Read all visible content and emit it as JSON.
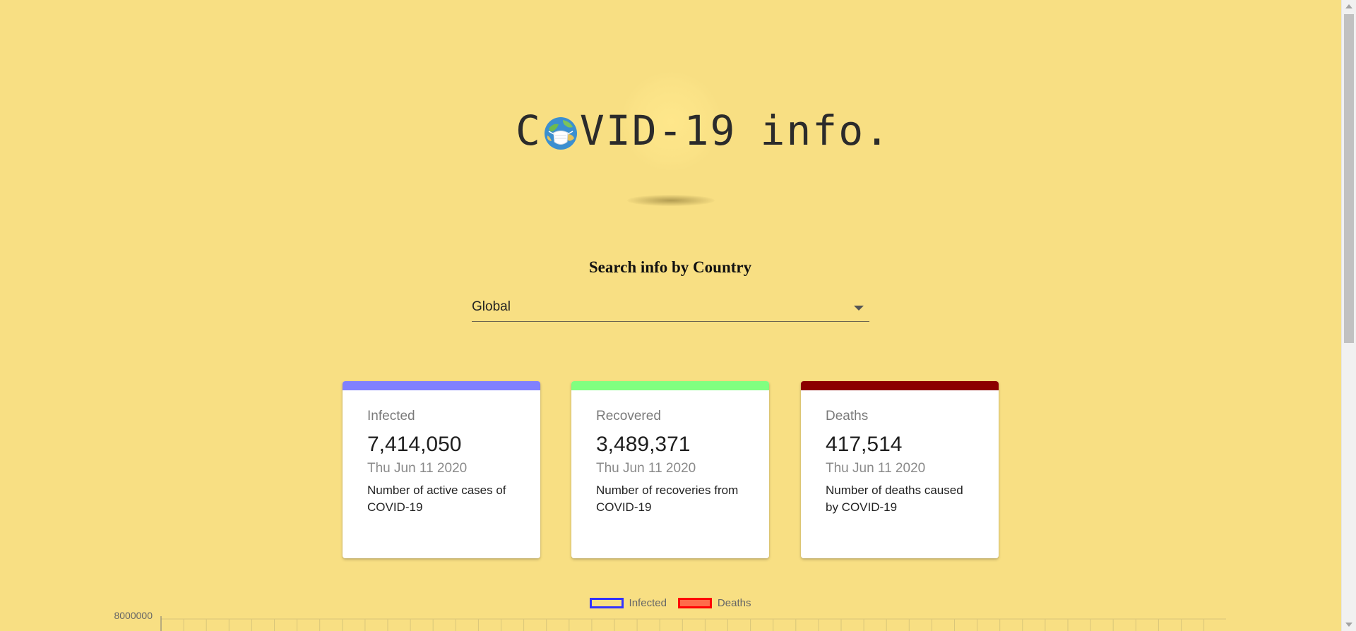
{
  "header": {
    "logo_text_before": "C",
    "logo_text_after": "VID-19",
    "logo_text_tail": "info."
  },
  "search": {
    "title": "Search info by Country",
    "selected": "Global"
  },
  "cards": [
    {
      "label": "Infected",
      "value": "7,414,050",
      "date": "Thu Jun 11 2020",
      "description": "Number of active cases of COVID-19",
      "color": "#8080ff"
    },
    {
      "label": "Recovered",
      "value": "3,489,371",
      "date": "Thu Jun 11 2020",
      "description": "Number of recoveries from COVID-19",
      "color": "#80ff80"
    },
    {
      "label": "Deaths",
      "value": "417,514",
      "date": "Thu Jun 11 2020",
      "description": "Number of deaths caused by COVID-19",
      "color": "#8b0000"
    }
  ],
  "chart_data": {
    "type": "line",
    "series": [
      {
        "name": "Infected",
        "color": "#3333ff",
        "fill": "transparent"
      },
      {
        "name": "Deaths",
        "color": "#ff0000",
        "fill": "#ff6b4a"
      }
    ],
    "y_ticks": [
      "8000000"
    ],
    "grid": true
  }
}
